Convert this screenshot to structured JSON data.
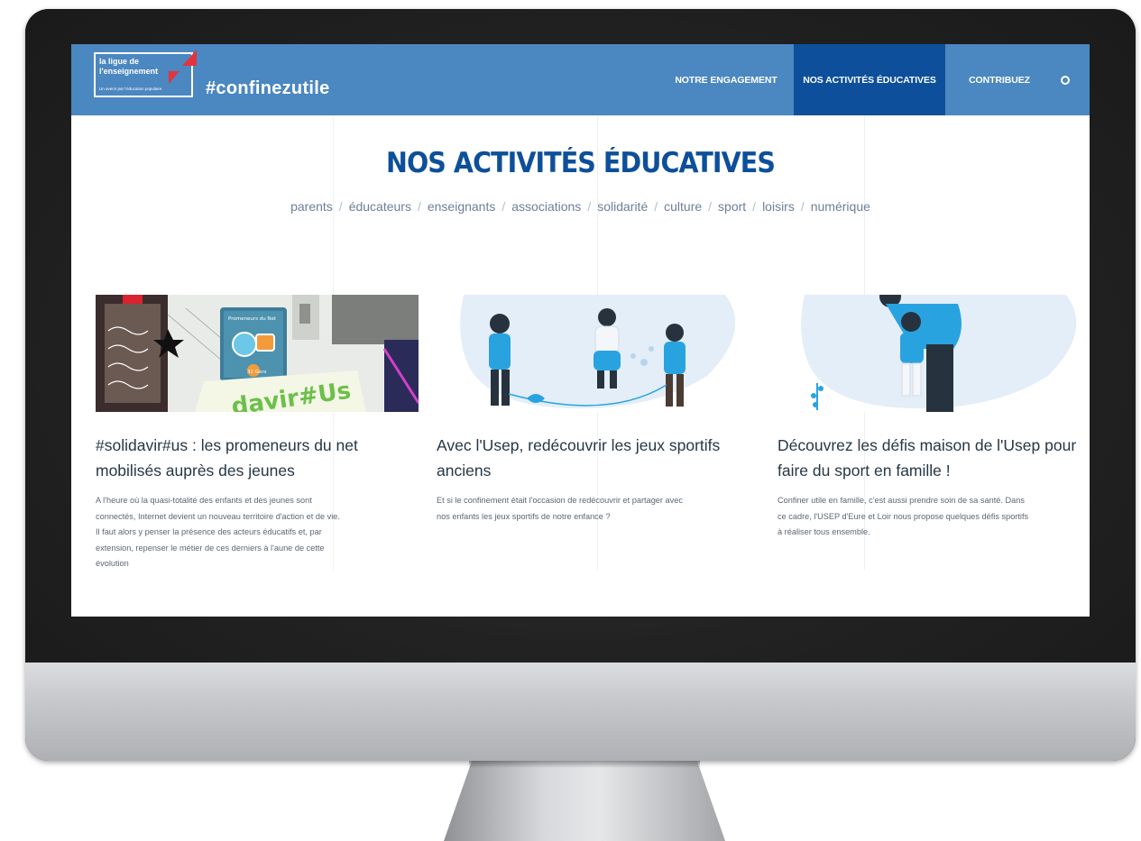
{
  "header": {
    "logo_line1": "la ligue de",
    "logo_line2": "l'enseignement",
    "logo_tag": "Un avenir par l'éducation populaire",
    "hashtag": "#confinezutile"
  },
  "nav": {
    "items": [
      {
        "label": "NOTRE ENGAGEMENT"
      },
      {
        "label": "NOS ACTIVITÉS ÉDUCATIVES",
        "active": true
      },
      {
        "label": "CONTRIBUEZ"
      }
    ],
    "search_icon": "search-icon"
  },
  "page": {
    "title": "NOS ACTIVITÉS ÉDUCATIVES",
    "filters": [
      "parents",
      "éducateurs",
      "enseignants",
      "associations",
      "solidarité",
      "culture",
      "sport",
      "loisirs",
      "numérique"
    ]
  },
  "cards": [
    {
      "title_line1": "#solidavir#us : les promeneurs du net",
      "title_line2": "mobilisés auprès des jeunes",
      "image_label": "Promeneurs du Net",
      "image_badge": "32 Gers",
      "image_word": "davir#Us",
      "text_line1": "A l'heure où la quasi-totalité des enfants et des jeunes sont",
      "text_line2": "connectés, Internet devient un nouveau territoire d'action et de vie.",
      "text_line3": "Il faut alors y penser la présence des acteurs éducatifs et, par",
      "text_line4": "extension, repenser le métier de ces derniers à l'aune de cette",
      "text_line5": "évolution"
    },
    {
      "title_line1": "Avec l'Usep, redécouvrir les jeux sportifs",
      "title_line2": "anciens",
      "text_line1": "Et si le confinement était l'occasion de redécouvrir et partager avec",
      "text_line2": "nos enfants les jeux sportifs de notre enfance ?"
    },
    {
      "title_line1": "Découvrez les défis maison de l'Usep pour",
      "title_line2": "faire du sport en famille !",
      "text_line1": "Confiner utile en famille, c'est aussi prendre soin de sa santé. Dans",
      "text_line2": "ce cadre, l'USEP d'Eure et Loir nous propose quelques défis sportifs",
      "text_line3": "à réaliser tous ensemble."
    }
  ],
  "colors": {
    "header_bg": "#4b87c0",
    "nav_active_bg": "#0d4f9a",
    "title_color": "#0d4f9a",
    "accent_red": "#e3343e",
    "illustration_blue": "#29a3e0"
  }
}
